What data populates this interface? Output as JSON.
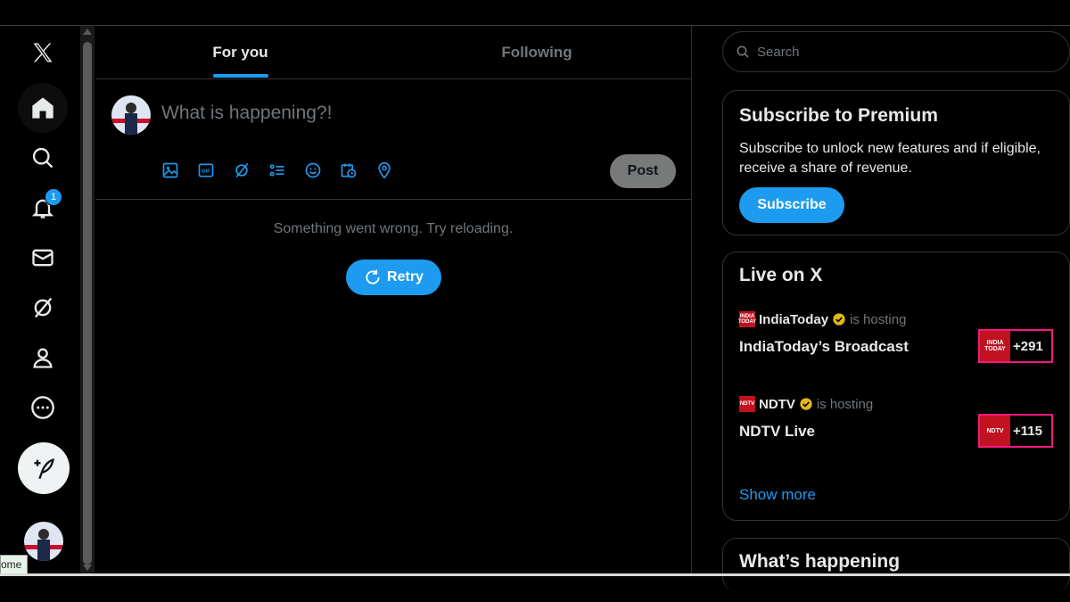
{
  "nav": {
    "items": [
      {
        "icon": "x-logo-icon"
      },
      {
        "icon": "home-icon"
      },
      {
        "icon": "search-icon"
      },
      {
        "icon": "bell-icon",
        "badge": "1"
      },
      {
        "icon": "mail-icon"
      },
      {
        "icon": "grok-icon"
      },
      {
        "icon": "profile-icon"
      },
      {
        "icon": "more-icon"
      }
    ],
    "tooltip": "ome"
  },
  "tabs": {
    "for_you": "For you",
    "following": "Following"
  },
  "composer": {
    "placeholder": "What is happening?!",
    "post_label": "Post"
  },
  "feed": {
    "error_message": "Something went wrong. Try reloading.",
    "retry_label": "Retry"
  },
  "search": {
    "placeholder": "Search"
  },
  "premium": {
    "title": "Subscribe to Premium",
    "description": "Subscribe to unlock new features and if eligible, receive a share of revenue.",
    "button": "Subscribe"
  },
  "live": {
    "title": "Live on X",
    "items": [
      {
        "host": "IndiaToday",
        "status": "is hosting",
        "broadcast": "IndiaToday’s Broadcast",
        "count": "+291",
        "logo_text": "INDIA TODAY"
      },
      {
        "host": "NDTV",
        "status": "is hosting",
        "broadcast": "NDTV Live",
        "count": "+115",
        "logo_text": "NDTV"
      }
    ],
    "show_more": "Show more"
  },
  "whats_happening": {
    "title": "What’s happening"
  },
  "colors": {
    "accent": "#1d9bf0",
    "background": "#000000",
    "muted_text": "#71767b",
    "live_border": "#f91880",
    "verified": "#e2b719"
  }
}
